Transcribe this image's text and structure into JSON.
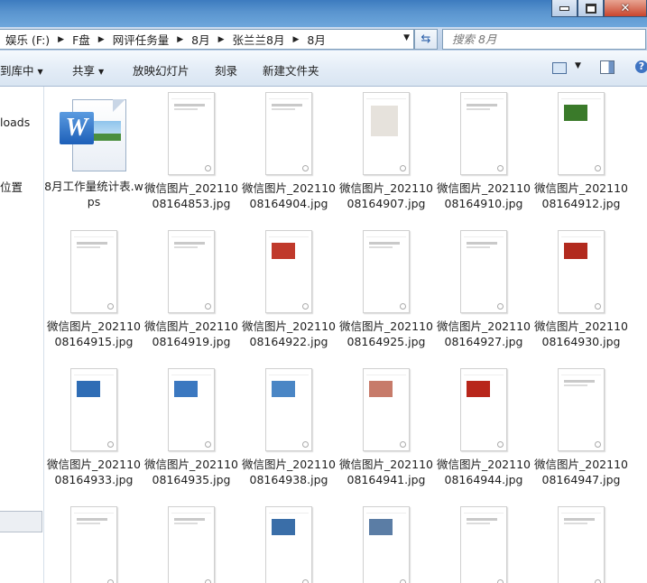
{
  "window": {
    "controls": [
      "minimize",
      "maximize",
      "close"
    ]
  },
  "address": {
    "crumbs": [
      "娱乐 (F:)",
      "F盘",
      "网评任务量",
      "8月",
      "张兰兰8月",
      "8月"
    ]
  },
  "search": {
    "placeholder": "搜索 8月"
  },
  "toolbar": {
    "library": "到库中",
    "share": "共享",
    "slideshow": "放映幻灯片",
    "burn": "刻录",
    "newfolder": "新建文件夹"
  },
  "nav": {
    "items": [
      "loads",
      "位置"
    ]
  },
  "files": [
    {
      "name": "8月工作量统计表.wps",
      "type": "wps"
    },
    {
      "name": "微信图片_20211008164853.jpg",
      "type": "jpg",
      "thumb": "text"
    },
    {
      "name": "微信图片_20211008164904.jpg",
      "type": "jpg",
      "thumb": "text"
    },
    {
      "name": "微信图片_20211008164907.jpg",
      "type": "jpg",
      "thumb": "gray"
    },
    {
      "name": "微信图片_20211008164910.jpg",
      "type": "jpg",
      "thumb": "text"
    },
    {
      "name": "微信图片_20211008164912.jpg",
      "type": "jpg",
      "thumb": "people",
      "color": "#3a7a2a"
    },
    {
      "name": "微信图片_20211008164915.jpg",
      "type": "jpg",
      "thumb": "text"
    },
    {
      "name": "微信图片_20211008164919.jpg",
      "type": "jpg",
      "thumb": "text"
    },
    {
      "name": "微信图片_20211008164922.jpg",
      "type": "jpg",
      "thumb": "people",
      "color": "#c0392b"
    },
    {
      "name": "微信图片_20211008164925.jpg",
      "type": "jpg",
      "thumb": "text"
    },
    {
      "name": "微信图片_20211008164927.jpg",
      "type": "jpg",
      "thumb": "text"
    },
    {
      "name": "微信图片_20211008164930.jpg",
      "type": "jpg",
      "thumb": "people",
      "color": "#b22a1e"
    },
    {
      "name": "微信图片_20211008164933.jpg",
      "type": "jpg",
      "thumb": "people",
      "color": "#2f6db5"
    },
    {
      "name": "微信图片_20211008164935.jpg",
      "type": "jpg",
      "thumb": "people",
      "color": "#3b78c0"
    },
    {
      "name": "微信图片_20211008164938.jpg",
      "type": "jpg",
      "thumb": "people",
      "color": "#4a86c5"
    },
    {
      "name": "微信图片_20211008164941.jpg",
      "type": "jpg",
      "thumb": "people",
      "color": "#c77b6a"
    },
    {
      "name": "微信图片_20211008164944.jpg",
      "type": "jpg",
      "thumb": "people",
      "color": "#b8261b"
    },
    {
      "name": "微信图片_20211008164947.jpg",
      "type": "jpg",
      "thumb": "text"
    },
    {
      "name": "",
      "type": "jpg",
      "thumb": "text"
    },
    {
      "name": "",
      "type": "jpg",
      "thumb": "text"
    },
    {
      "name": "",
      "type": "jpg",
      "thumb": "people",
      "color": "#3a6ea8"
    },
    {
      "name": "",
      "type": "jpg",
      "thumb": "people",
      "color": "#5b7da5"
    },
    {
      "name": "",
      "type": "jpg",
      "thumb": "text"
    },
    {
      "name": "",
      "type": "jpg",
      "thumb": "text"
    }
  ]
}
